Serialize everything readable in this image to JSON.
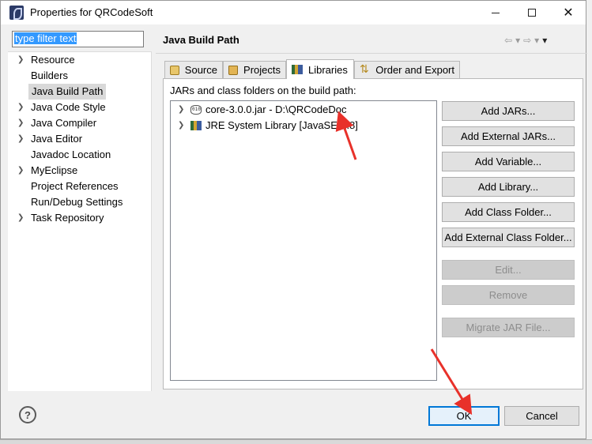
{
  "window": {
    "title": "Properties for QRCodeSoft"
  },
  "filter": {
    "value": "type filter text"
  },
  "nav": {
    "items": [
      {
        "label": "Resource",
        "expandable": true
      },
      {
        "label": "Builders",
        "expandable": false
      },
      {
        "label": "Java Build Path",
        "expandable": false,
        "selected": true
      },
      {
        "label": "Java Code Style",
        "expandable": true
      },
      {
        "label": "Java Compiler",
        "expandable": true
      },
      {
        "label": "Java Editor",
        "expandable": true
      },
      {
        "label": "Javadoc Location",
        "expandable": false
      },
      {
        "label": "MyEclipse",
        "expandable": true
      },
      {
        "label": "Project References",
        "expandable": false
      },
      {
        "label": "Run/Debug Settings",
        "expandable": false
      },
      {
        "label": "Task Repository",
        "expandable": true
      }
    ]
  },
  "page": {
    "title": "Java Build Path"
  },
  "tabs": [
    {
      "label": "Source",
      "icon": "source-folder-icon"
    },
    {
      "label": "Projects",
      "icon": "project-icon"
    },
    {
      "label": "Libraries",
      "icon": "library-icon",
      "active": true
    },
    {
      "label": "Order and Export",
      "icon": "order-export-icon"
    }
  ],
  "libraries": {
    "label": "JARs and class folders on the build path:",
    "entries": [
      {
        "label": "core-3.0.0.jar - D:\\QRCodeDoc",
        "icon": "jar-icon"
      },
      {
        "label": "JRE System Library [JavaSE-1.8]",
        "icon": "jre-library-icon"
      }
    ]
  },
  "buttons": {
    "add_jars": "Add JARs...",
    "add_external_jars": "Add External JARs...",
    "add_variable": "Add Variable...",
    "add_library": "Add Library...",
    "add_class_folder": "Add Class Folder...",
    "add_external_class_folder": "Add External Class Folder...",
    "edit": "Edit...",
    "remove": "Remove",
    "migrate_jar": "Migrate JAR File..."
  },
  "footer": {
    "help": "?",
    "ok": "OK",
    "cancel": "Cancel"
  },
  "colors": {
    "accent": "#0078d7",
    "annotation_arrow": "#e8312a",
    "selection": "#3399ff"
  }
}
